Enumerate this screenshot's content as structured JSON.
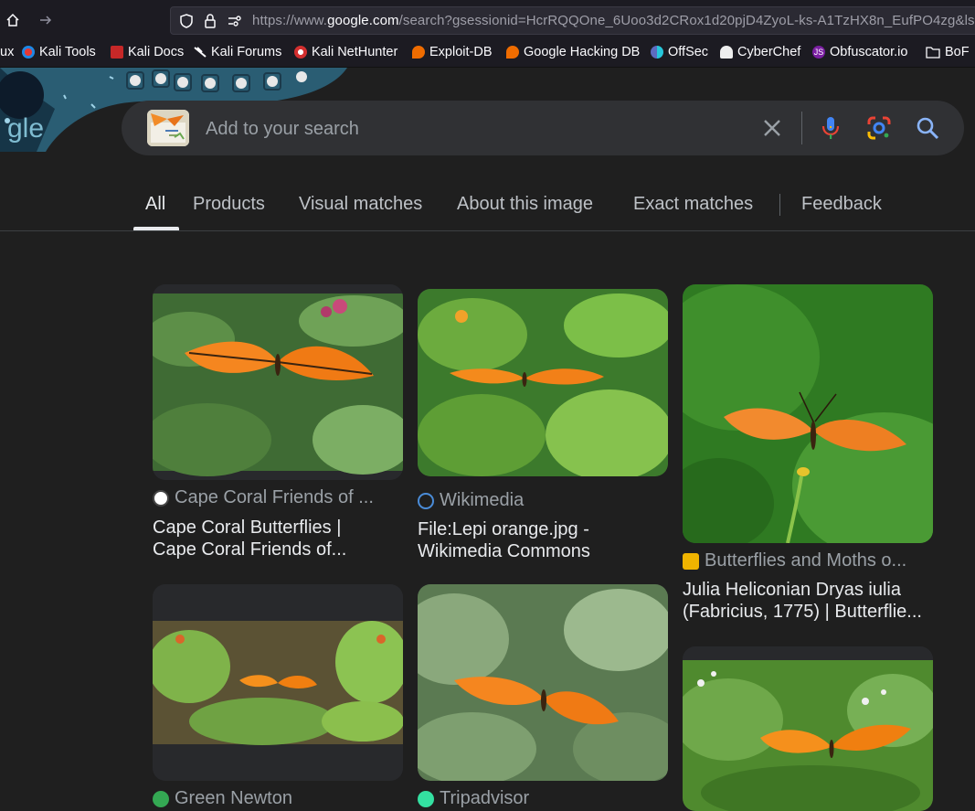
{
  "browser": {
    "url_prefix": "https://www.",
    "url_host": "google.com",
    "url_rest": "/search?gsessionid=HcrRQQOne_6Uoo3d2CRox1d20pjD4ZyoL-ks-A1TzHX8n_EufPO4zg&ls",
    "bookmarks": [
      {
        "label": "ux",
        "icon": "none"
      },
      {
        "label": "Kali Tools",
        "icon": "kali-icon"
      },
      {
        "label": "Kali Docs",
        "icon": "kali-docs-icon"
      },
      {
        "label": "Kali Forums",
        "icon": "kali-dragon-icon"
      },
      {
        "label": "Kali NetHunter",
        "icon": "nethunter-icon"
      },
      {
        "label": "Exploit-DB",
        "icon": "exploitdb-icon"
      },
      {
        "label": "Google Hacking DB",
        "icon": "exploitdb-icon"
      },
      {
        "label": "OffSec",
        "icon": "offsec-icon"
      },
      {
        "label": "CyberChef",
        "icon": "cyberchef-icon"
      },
      {
        "label": "Obfuscator.io",
        "icon": "js-icon"
      },
      {
        "label": "BoF",
        "icon": "folder-icon"
      }
    ]
  },
  "google": {
    "logo_fragment": "gle",
    "search": {
      "placeholder": "Add to your search"
    },
    "tabs": [
      "All",
      "Products",
      "Visual matches",
      "About this image",
      "Exact matches",
      "Feedback"
    ],
    "active_tab": "All"
  },
  "results": [
    {
      "source": "Cape Coral Friends of ...",
      "title_line1": "Cape Coral Butterflies |",
      "title_line2": "Cape Coral Friends of...",
      "image": "orange butterfly on leaves"
    },
    {
      "source": "Wikimedia",
      "title_line1": "File:Lepi orange.jpg -",
      "title_line2": "Wikimedia Commons",
      "image": "orange butterfly on green leaves"
    },
    {
      "source": "Butterflies and Moths o...",
      "title_line1": "Julia Heliconian Dryas iulia",
      "title_line2": "(Fabricius, 1775) | Butterflie...",
      "image": "orange butterfly on green background"
    },
    {
      "source": "Green Newton",
      "title_line1": "",
      "title_line2": "",
      "image": "orange butterfly in shrubs"
    },
    {
      "source": "Tripadvisor",
      "title_line1": "",
      "title_line2": "",
      "image": "orange butterfly on leaves"
    },
    {
      "source": "",
      "title_line1": "",
      "title_line2": "",
      "image": "orange butterfly on flowers"
    }
  ],
  "colors": {
    "page_bg": "#1f1f1f",
    "searchbox_bg": "#303134",
    "accent_blue": "#8ab4f8",
    "butterfly_orange": "#f5861f"
  }
}
